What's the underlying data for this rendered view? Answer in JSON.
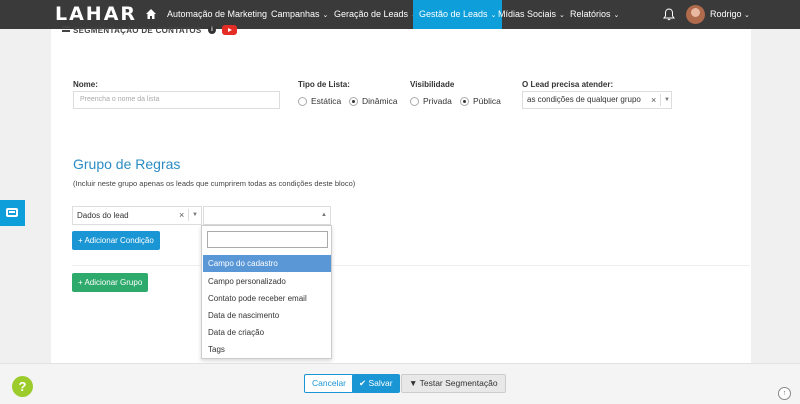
{
  "nav": {
    "logo": "LAHAR",
    "items": [
      {
        "label": "Automação de Marketing",
        "caret": ""
      },
      {
        "label": "Campanhas",
        "caret": "⌄"
      },
      {
        "label": "Geração de Leads",
        "caret": "⌄"
      },
      {
        "label": "Gestão de Leads",
        "caret": "⌄"
      },
      {
        "label": "Mídias Sociais",
        "caret": "⌄"
      },
      {
        "label": "Relatórios",
        "caret": "⌄"
      }
    ],
    "user": "Rodrigo",
    "user_caret": "⌄"
  },
  "page": {
    "heading": "SEGMENTAÇÃO DE CONTATOS",
    "info_icon": "i"
  },
  "form": {
    "name_label": "Nome:",
    "name_placeholder": "Preencha o nome da lista",
    "list_type_label": "Tipo de Lista:",
    "list_type_options": [
      "Estática",
      "Dinâmica"
    ],
    "visibility_label": "Visibilidade",
    "visibility_options": [
      "Privada",
      "Pública"
    ],
    "condition_label": "O Lead precisa atender:",
    "condition_value": "as condições de qualquer grupo"
  },
  "rules": {
    "title": "Grupo de Regras",
    "description": "(Incluir neste grupo apenas os leads que cumprirem todas as condições deste bloco)",
    "field_select": "Dados do lead",
    "add_condition": "+ Adicionar Condição",
    "add_group": "+ Adicionar Grupo",
    "dropdown_options": [
      "Campo do cadastro",
      "Campo personalizado",
      "Contato pode receber email",
      "Data de nascimento",
      "Data de criação",
      "Tags"
    ]
  },
  "footer": {
    "cancel": "Cancelar",
    "save": "✔ Salvar",
    "test": "▼ Testar Segmentação",
    "help": "?"
  },
  "colors": {
    "nav_bg": "#3a3a3a",
    "accent": "#0e9ed9",
    "green": "#2eaa6c",
    "title_blue": "#2b8cc4",
    "highlight": "#5a97d6"
  }
}
